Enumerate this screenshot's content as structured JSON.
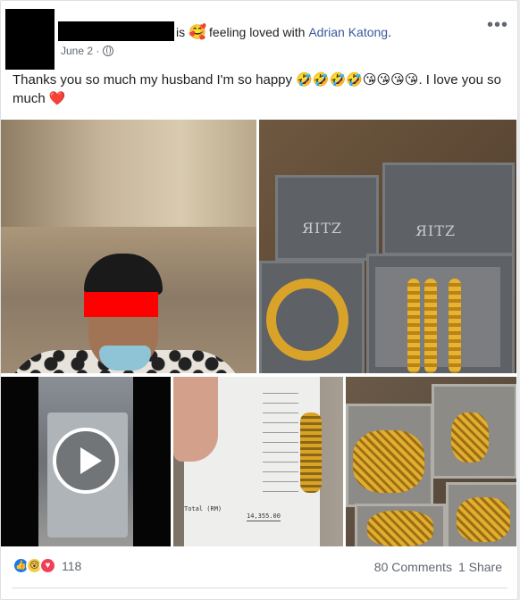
{
  "post": {
    "headline_verb": "is",
    "feeling_emoji": "🥰",
    "feeling_text": "feeling loved with",
    "tagged_name": "Adrian Katong",
    "headline_end": ".",
    "date": "June 2 ·",
    "privacy_icon": "globe-icon",
    "more_icon": "•••",
    "text": "Thanks you so much my husband I'm so happy 🤣🤣🤣🤣😘😘😘😘. I love you so much",
    "text_heart": "❤️"
  },
  "media": {
    "photo2_logo": "ЯIТZ",
    "receipt_total_label": "Total (RM)",
    "receipt_total_value": "14,355.00",
    "video_play_icon": "play-icon"
  },
  "footer": {
    "reaction_icons": [
      "like-icon",
      "wow-icon",
      "love-icon"
    ],
    "reaction_count": "118",
    "comments": "80 Comments",
    "shares": "1 Share"
  },
  "colors": {
    "link": "#385898",
    "meta": "#616770",
    "like": "#1877f2",
    "love": "#f33e58",
    "wow": "#f7c845",
    "redaction": "#ff0000"
  }
}
